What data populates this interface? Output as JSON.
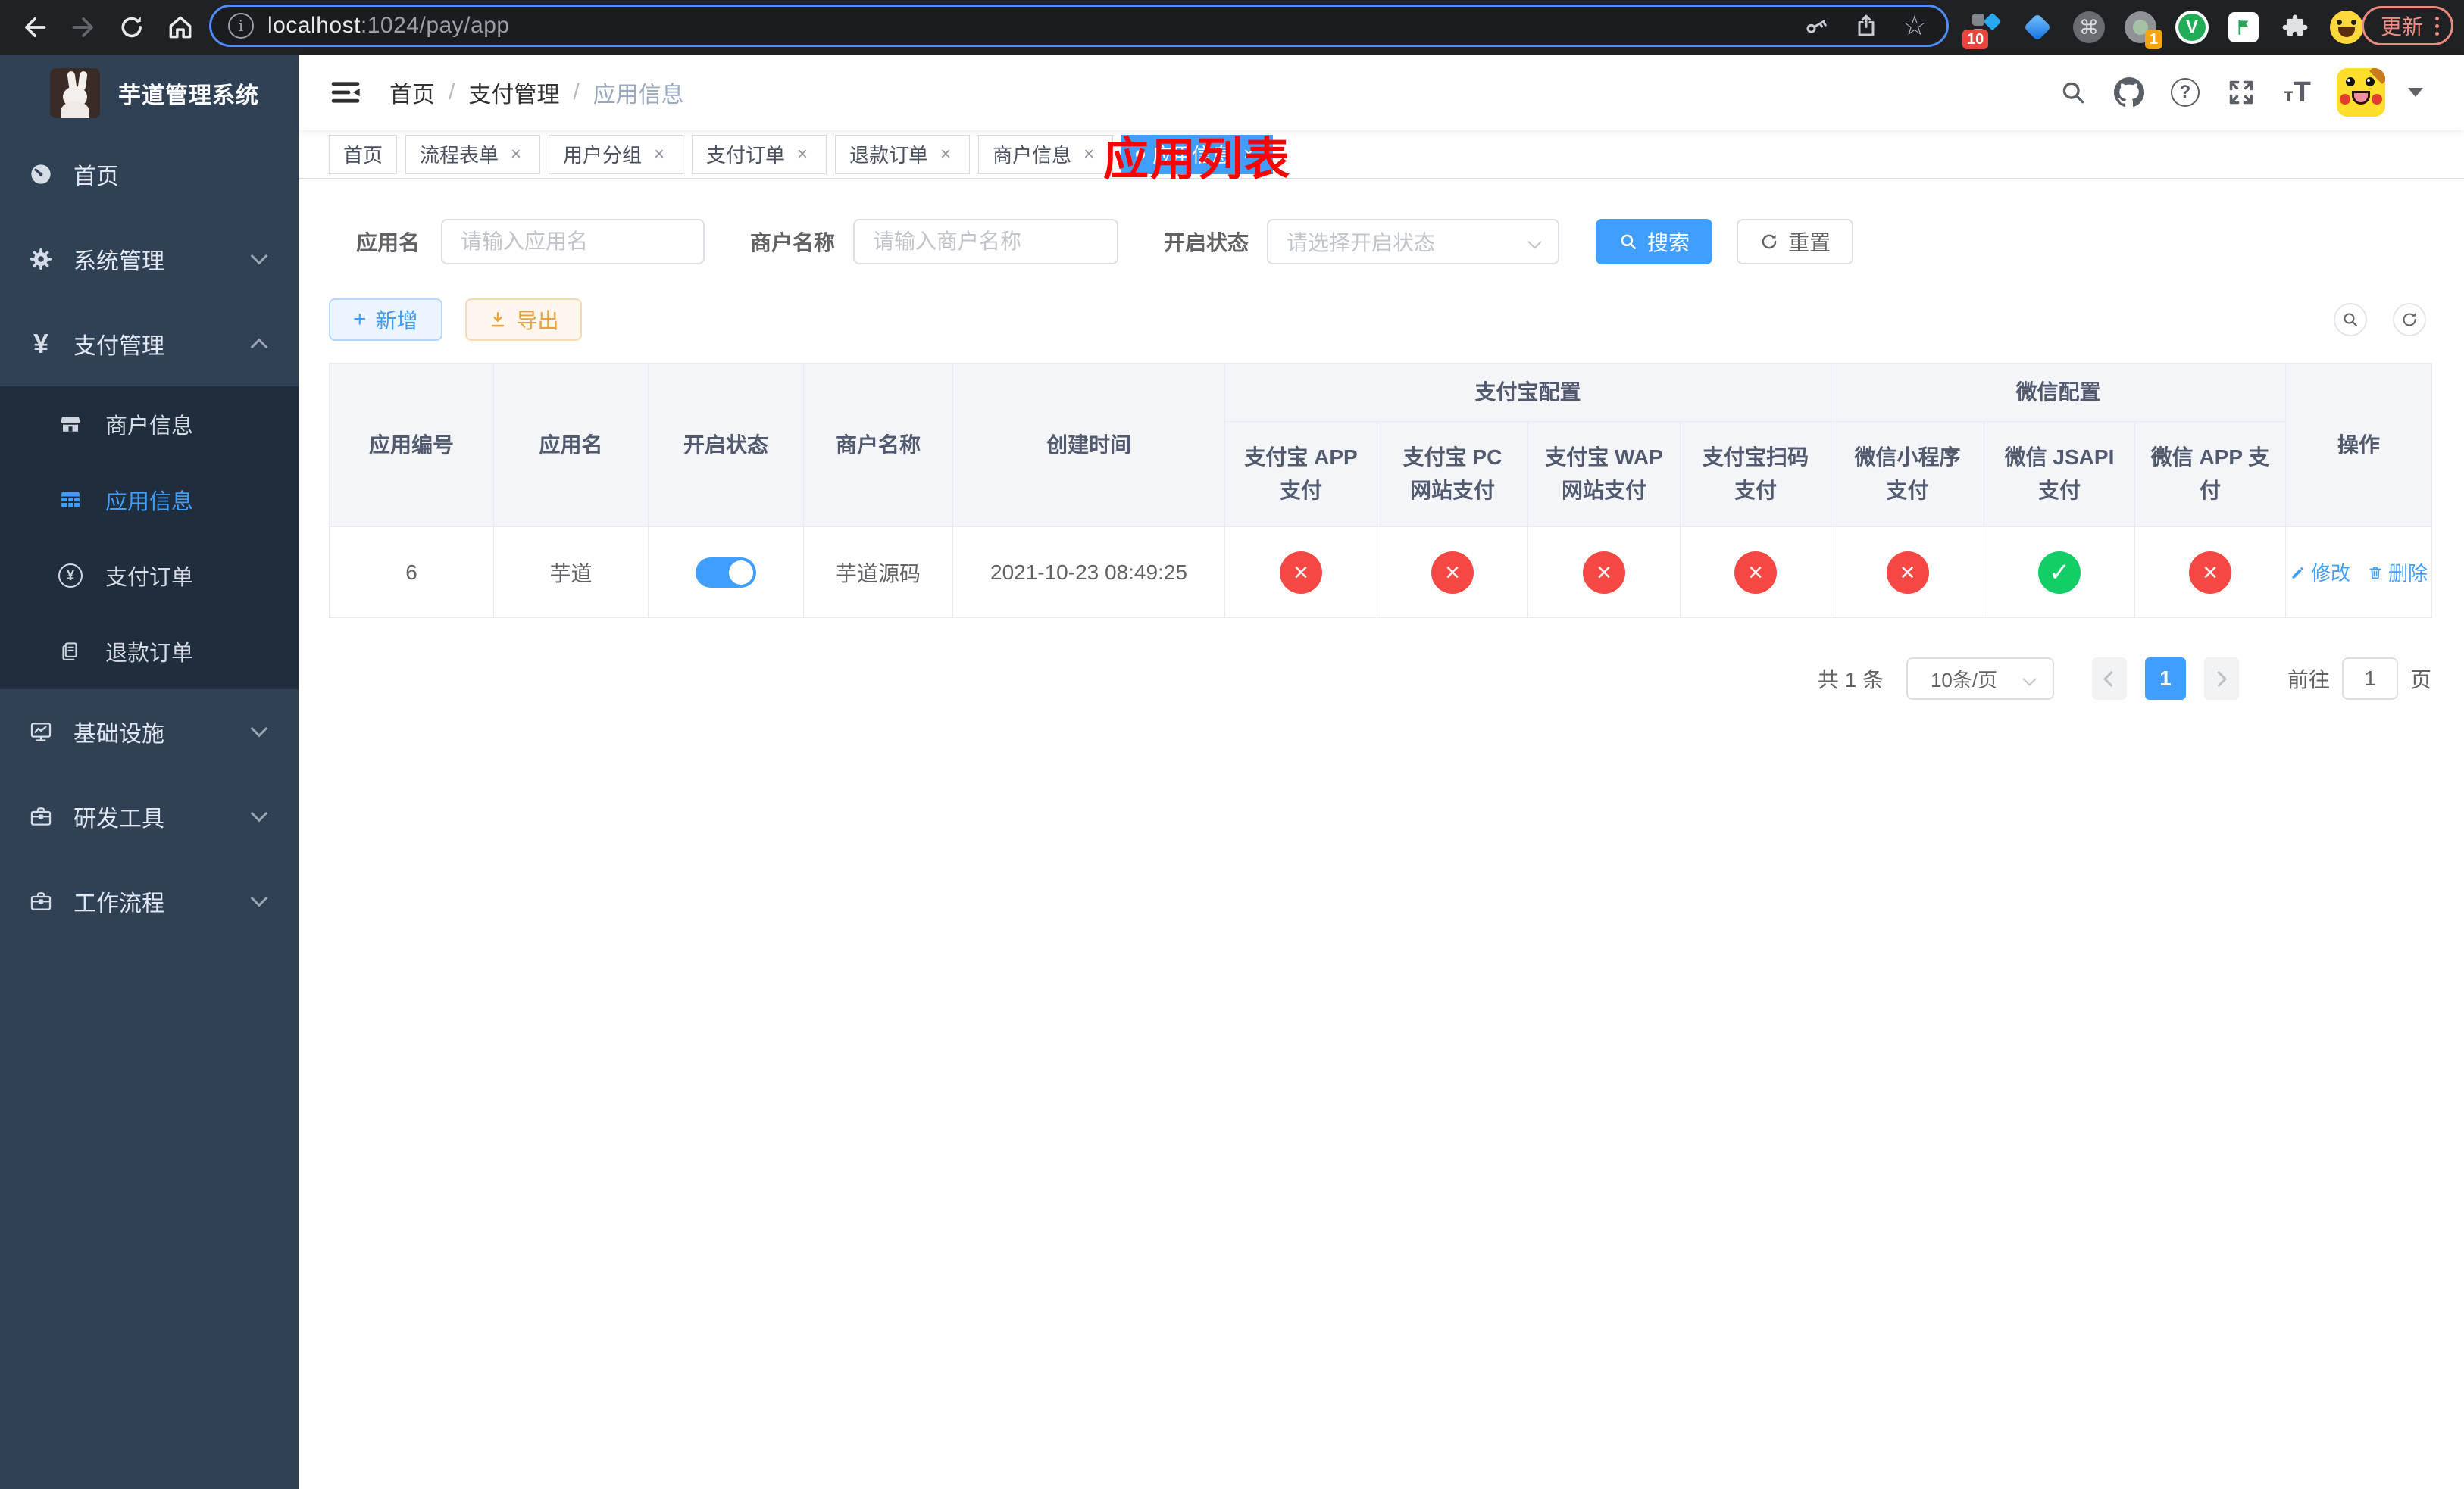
{
  "colors": {
    "accent": "#409eff",
    "danger": "#f54743",
    "success": "#13ce66",
    "title_red": "#ff0000",
    "warning": "#e6a23c"
  },
  "browser": {
    "url_host": "localhost",
    "url_path": ":1024/pay/app",
    "update_label": "更新",
    "ext_badge_a": "10",
    "ext_badge_b": "1"
  },
  "sidebar": {
    "title": "芋道管理系统",
    "items": [
      {
        "label": "首页"
      },
      {
        "label": "系统管理"
      },
      {
        "label": "支付管理"
      },
      {
        "label": "基础设施"
      },
      {
        "label": "研发工具"
      },
      {
        "label": "工作流程"
      }
    ],
    "payment_submenu": [
      {
        "label": "商户信息"
      },
      {
        "label": "应用信息",
        "active": true
      },
      {
        "label": "支付订单"
      },
      {
        "label": "退款订单"
      }
    ]
  },
  "navbar": {
    "breadcrumb": [
      "首页",
      "支付管理",
      "应用信息"
    ],
    "separator": "/",
    "title": "应用列表"
  },
  "tabs": [
    {
      "label": "首页",
      "closable": false,
      "active": false
    },
    {
      "label": "流程表单",
      "closable": true,
      "active": false
    },
    {
      "label": "用户分组",
      "closable": true,
      "active": false
    },
    {
      "label": "支付订单",
      "closable": true,
      "active": false
    },
    {
      "label": "退款订单",
      "closable": true,
      "active": false
    },
    {
      "label": "商户信息",
      "closable": true,
      "active": false
    },
    {
      "label": "应用信息",
      "closable": true,
      "active": true
    }
  ],
  "filters": {
    "app_name_label": "应用名",
    "app_name_placeholder": "请输入应用名",
    "merchant_label": "商户名称",
    "merchant_placeholder": "请输入商户名称",
    "status_label": "开启状态",
    "status_placeholder": "请选择开启状态",
    "search_label": "搜索",
    "reset_label": "重置"
  },
  "toolbar": {
    "add_label": "新增",
    "export_label": "导出"
  },
  "table": {
    "columns": [
      "应用编号",
      "应用名",
      "开启状态",
      "商户名称",
      "创建时间"
    ],
    "group_alipay": "支付宝配置",
    "group_wechat": "微信配置",
    "alipay_cols": [
      "支付宝 APP 支付",
      "支付宝 PC 网站支付",
      "支付宝 WAP 网站支付",
      "支付宝扫码支付"
    ],
    "wechat_cols": [
      "微信小程序支付",
      "微信 JSAPI 支付",
      "微信 APP 支付"
    ],
    "action_col": "操作",
    "rows": [
      {
        "id": "6",
        "name": "芋道",
        "enabled": true,
        "merchant": "芋道源码",
        "created_at": "2021-10-23 08:49:25",
        "configs": [
          false,
          false,
          false,
          false,
          false,
          true,
          false
        ],
        "actions": {
          "edit": "修改",
          "delete": "删除"
        }
      }
    ]
  },
  "pagination": {
    "total": "共 1 条",
    "page_size": "10条/页",
    "current_page": "1",
    "goto_label": "前往",
    "goto_value": "1",
    "unit_label": "页"
  }
}
